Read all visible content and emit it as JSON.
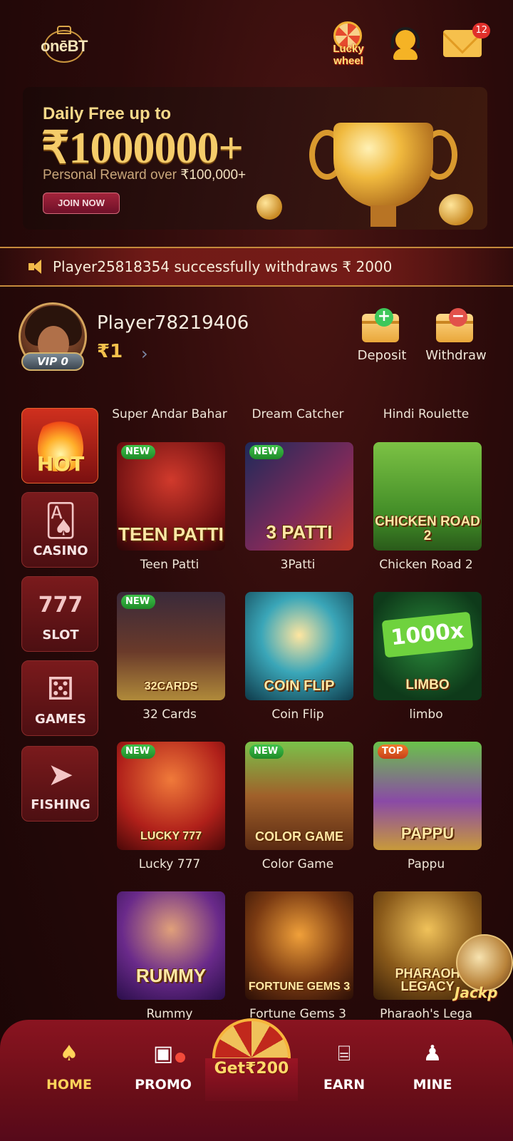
{
  "header": {
    "logo_text": "onēBT",
    "lucky_wheel_label": "Lucky wheel",
    "mail_badge": "12"
  },
  "banner": {
    "title": "Daily Free up to",
    "amount": "₹1000000+",
    "subtitle": "Personal Reward over",
    "subtitle_amount": "₹100,000+",
    "join_button": "JOIN NOW"
  },
  "ticker": {
    "message": "Player25818354 successfully withdraws ₹ 2000"
  },
  "profile": {
    "username": "Player78219406",
    "balance": "₹1",
    "vip_level": "VIP 0",
    "deposit_label": "Deposit",
    "withdraw_label": "Withdraw"
  },
  "categories": [
    {
      "label": "HOT",
      "icon": "flame-icon"
    },
    {
      "label": "CASINO",
      "icon": "cards-icon"
    },
    {
      "label": "SLOT",
      "icon": "slot-machine-icon"
    },
    {
      "label": "GAMES",
      "icon": "dice-icon"
    },
    {
      "label": "FISHING",
      "icon": "shark-icon"
    }
  ],
  "top_row_titles": [
    "Super Andar Bahar",
    "Dream Catcher",
    "Hindi Roulette"
  ],
  "games": [
    {
      "name": "Teen Patti",
      "art_text": "TEEN PATTI",
      "tag": "NEW"
    },
    {
      "name": "3Patti",
      "art_text": "3 PATTI",
      "tag": "NEW"
    },
    {
      "name": "Chicken Road 2",
      "art_text": "CHICKEN ROAD 2",
      "tag": ""
    },
    {
      "name": "32 Cards",
      "art_text": "32CARDS",
      "tag": "NEW"
    },
    {
      "name": "Coin Flip",
      "art_text": "COIN FLIP",
      "tag": ""
    },
    {
      "name": "limbo",
      "art_text": "LIMBO",
      "tag": "",
      "extra_text": "1000x"
    },
    {
      "name": "Lucky 777",
      "art_text": "LUCKY 777",
      "tag": "NEW"
    },
    {
      "name": "Color Game",
      "art_text": "COLOR GAME",
      "tag": "NEW"
    },
    {
      "name": "Pappu",
      "art_text": "PAPPU",
      "tag": "TOP"
    },
    {
      "name": "Rummy",
      "art_text": "RUMMY",
      "tag": ""
    },
    {
      "name": "Fortune Gems 3",
      "art_text": "FORTUNE GEMS 3",
      "tag": ""
    },
    {
      "name": "Pharaoh's Lega",
      "art_text": "PHARAOH LEGACY",
      "tag": ""
    }
  ],
  "floating": {
    "jackpot_label": "Jackp"
  },
  "nav": {
    "home": "HOME",
    "promo": "PROMO",
    "get_bonus": "Get₹200",
    "earn": "EARN",
    "mine": "MINE"
  },
  "colors": {
    "accent_gold": "#f4c14c",
    "background": "#2a0a0a",
    "nav_red": "#8a1420",
    "new_tag": "#3fc24b"
  }
}
